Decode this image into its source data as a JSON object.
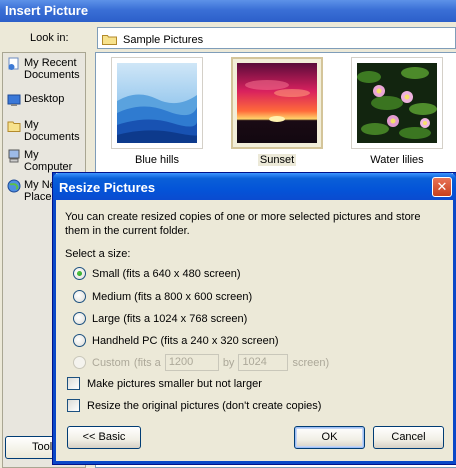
{
  "insert_window": {
    "title": "Insert Picture",
    "look_in_label": "Look in:",
    "look_in_value": "Sample Pictures",
    "places": [
      {
        "label": "My Recent Documents",
        "icon": "recent-documents-icon"
      },
      {
        "label": "Desktop",
        "icon": "desktop-icon"
      },
      {
        "label": "My Documents",
        "icon": "my-documents-icon"
      },
      {
        "label": "My Computer",
        "icon": "my-computer-icon"
      },
      {
        "label": "My Network Places",
        "icon": "network-places-icon"
      }
    ],
    "thumbnails": [
      {
        "label": "Blue hills",
        "selected": false
      },
      {
        "label": "Sunset",
        "selected": true
      },
      {
        "label": "Water lilies",
        "selected": false
      }
    ],
    "tools_label": "Tools"
  },
  "resize_dialog": {
    "title": "Resize Pictures",
    "intro": "You can create resized copies of one or more selected pictures and store them in the current folder.",
    "select_label": "Select a size:",
    "options": [
      {
        "label": "Small (fits a 640 x 480 screen)",
        "selected": true
      },
      {
        "label": "Medium (fits a 800 x 600 screen)",
        "selected": false
      },
      {
        "label": "Large (fits a 1024 x 768 screen)",
        "selected": false
      },
      {
        "label": "Handheld PC (fits a 240 x 320 screen)",
        "selected": false
      }
    ],
    "custom": {
      "label": "Custom",
      "fits_a": "(fits a",
      "width": "1200",
      "by": "by",
      "height": "1024",
      "screen": "screen)",
      "enabled": false
    },
    "checkboxes": [
      {
        "label": "Make pictures smaller but not larger",
        "checked": false
      },
      {
        "label": "Resize the original pictures (don't create copies)",
        "checked": false
      }
    ],
    "buttons": {
      "basic": "<< Basic",
      "ok": "OK",
      "cancel": "Cancel"
    },
    "close_glyph": "✕"
  },
  "colors": {
    "title_blue": "#0454d8",
    "dialog_face": "#ece9d8",
    "close_red": "#c6401d"
  }
}
